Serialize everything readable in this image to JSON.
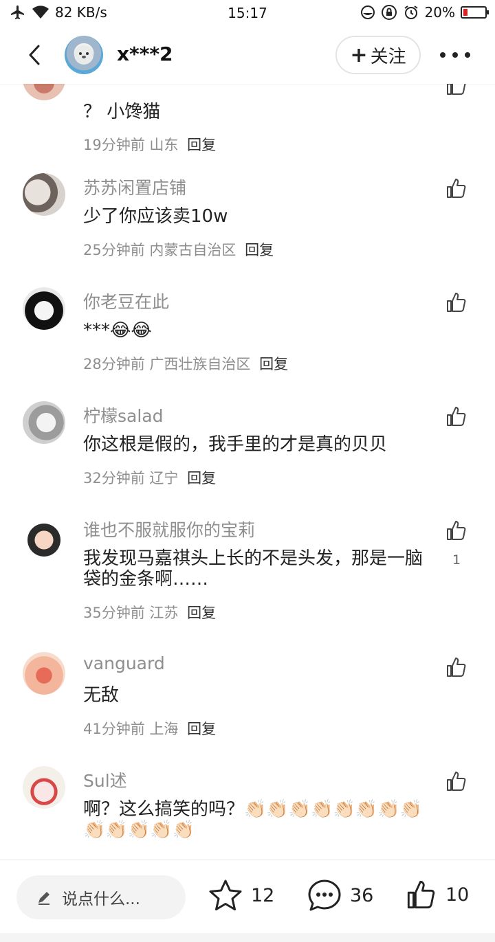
{
  "status_bar": {
    "network_speed": "82 KB/s",
    "time": "15:17",
    "battery": "20%",
    "battery_level": 0.2
  },
  "header": {
    "username": "x***2",
    "follow_label": "关注"
  },
  "comments": [
    {
      "name": "",
      "text": "？ 小馋猫",
      "time": "19分钟前",
      "location": "山东",
      "reply": "回复",
      "likes": ""
    },
    {
      "name": "苏苏闲置店铺",
      "text": "少了你应该卖10w",
      "time": "25分钟前",
      "location": "内蒙古自治区",
      "reply": "回复",
      "likes": ""
    },
    {
      "name": "你老豆在此",
      "text": "***😂😂",
      "time": "28分钟前",
      "location": "广西壮族自治区",
      "reply": "回复",
      "likes": ""
    },
    {
      "name": "柠檬salad",
      "text": "你这根是假的，我手里的才是真的贝贝",
      "time": "32分钟前",
      "location": "辽宁",
      "reply": "回复",
      "likes": ""
    },
    {
      "name": "谁也不服就服你的宝莉",
      "text": "我发现马嘉祺头上长的不是头发，那是一脑袋的金条啊……",
      "time": "35分钟前",
      "location": "江苏",
      "reply": "回复",
      "likes": "1"
    },
    {
      "name": "vanguard",
      "text": "无敌",
      "time": "41分钟前",
      "location": "上海",
      "reply": "回复",
      "likes": ""
    },
    {
      "name": "Sul述",
      "text": "啊？这么搞笑的吗？👏🏻👏🏻👏🏻👏🏻👏🏻👏🏻👏🏻👏🏻👏🏻👏🏻👏🏻👏🏻👏🏻",
      "time": "",
      "location": "",
      "reply": "",
      "likes": ""
    }
  ],
  "bottom_bar": {
    "input_placeholder": "说点什么...",
    "favorites": "12",
    "comments": "36",
    "likes": "10"
  },
  "colors": {
    "secondary_text": "#8e8e8e",
    "primary_text": "#222222",
    "battery_low": "#e02020"
  }
}
